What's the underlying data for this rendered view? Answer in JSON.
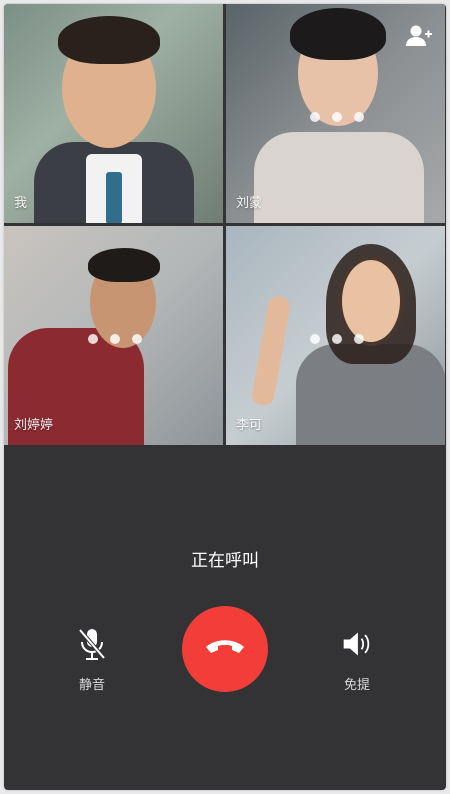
{
  "participants": [
    {
      "name": "我"
    },
    {
      "name": "刘蒙"
    },
    {
      "name": "刘婷婷"
    },
    {
      "name": "李可"
    }
  ],
  "call": {
    "status": "正在呼叫"
  },
  "controls": {
    "mute_label": "静音",
    "speaker_label": "免提"
  },
  "icons": {
    "add_user": "add-user-icon",
    "mute": "microphone-muted-icon",
    "hangup": "phone-hangup-icon",
    "speaker": "speaker-icon"
  },
  "colors": {
    "background": "#333336",
    "hangup": "#f23d39",
    "text": "#ffffff"
  }
}
